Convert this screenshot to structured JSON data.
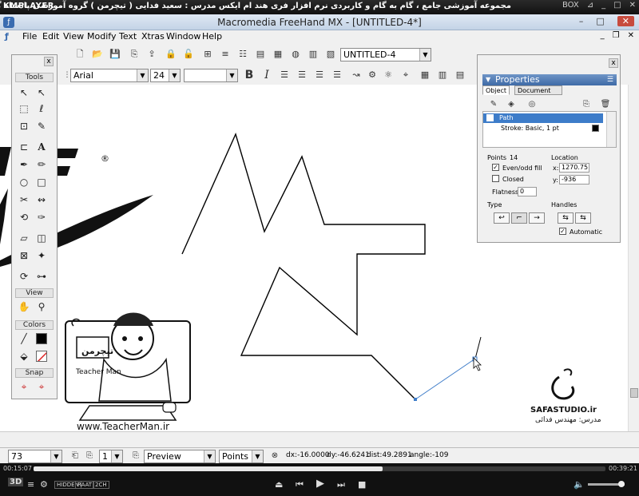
{
  "player": {
    "logo": "KMPLAYER",
    "title": "مجموعه آموزشی جامع ، گام به گام و کاربردی نرم افزار فری هند ام ایکس مدرس : سعید فدایی ( تیچرمن ) گروه آموزشی پادشاه گرافیست ها",
    "box_label": "BOX",
    "time_current": "00:15:07",
    "time_total": "00:39:21",
    "progress": 0.61,
    "buttons": [
      "3D",
      "≡",
      "⚙",
      "HIDDEN",
      "RAAT",
      "2CH"
    ]
  },
  "app": {
    "title": "Macromedia FreeHand MX - [UNTITLED-4*]",
    "menu": [
      "File",
      "Edit",
      "View",
      "Modify",
      "Text",
      "Xtras",
      "Window",
      "Help"
    ]
  },
  "toolbar": {
    "document_select": "UNTITLED-4",
    "font_family": "Arial",
    "font_size": "24",
    "font_style": "",
    "bold": "B",
    "italic": "I"
  },
  "tools_panel": {
    "close": "x",
    "tools_header": "Tools",
    "view_header": "View",
    "colors_header": "Colors",
    "snap_header": "Snap"
  },
  "properties_panel": {
    "close": "x",
    "title": "Properties",
    "tabs": [
      "Object",
      "Document"
    ],
    "selected_item": "Path",
    "sub_item": "Stroke: Basic, 1 pt",
    "points_label": "Points",
    "points_value": "14",
    "evenodd_label": "Even/odd fill",
    "evenodd_checked": true,
    "closed_label": "Closed",
    "closed_checked": false,
    "flatness_label": "Flatness:",
    "flatness_value": "0",
    "type_label": "Type",
    "location_label": "Location",
    "x_label": "x:",
    "x_value": "1270.75",
    "y_label": "y:",
    "y_value": "-936",
    "handles_label": "Handles",
    "automatic_label": "Automatic",
    "automatic_checked": true
  },
  "status_bar": {
    "zoom": "73",
    "page": "1",
    "view_mode": "Preview",
    "units": "Points",
    "dx": "dx:-16.0000",
    "dy": "dy:-46.6241",
    "dist": "dist:49.2891",
    "angle": "angle:-109"
  },
  "watermarks": {
    "teacher_site": "www.TeacherMan.ir",
    "teacher_name": "Teacher Man",
    "teacher_logo_text": "تیچرمن",
    "safa_site": "SAFASTUDIO.ir",
    "safa_teacher": "مدرس: مهندس فدائی"
  },
  "colors": {
    "selection_blue": "#3d7cc9",
    "panel_header": "#3e6aa6",
    "close_red": "#c74b3e"
  }
}
